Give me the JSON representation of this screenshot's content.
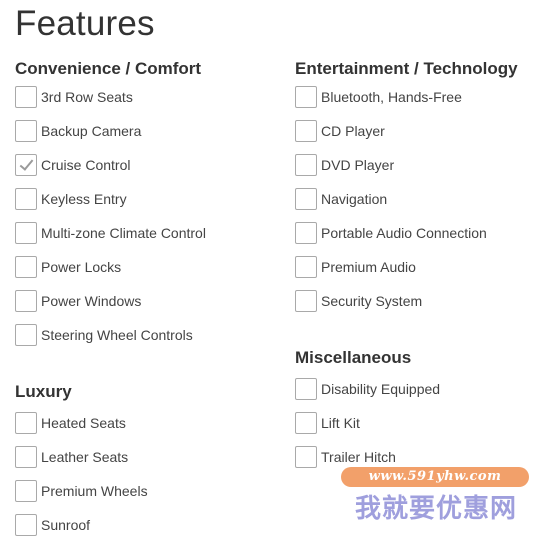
{
  "page": {
    "title": "Features"
  },
  "groups": {
    "convenience": {
      "heading": "Convenience / Comfort",
      "items": [
        {
          "label": "3rd Row Seats",
          "checked": false
        },
        {
          "label": "Backup Camera",
          "checked": false
        },
        {
          "label": "Cruise Control",
          "checked": true
        },
        {
          "label": "Keyless Entry",
          "checked": false
        },
        {
          "label": "Multi-zone Climate Control",
          "checked": false
        },
        {
          "label": "Power Locks",
          "checked": false
        },
        {
          "label": "Power Windows",
          "checked": false
        },
        {
          "label": "Steering Wheel Controls",
          "checked": false
        }
      ]
    },
    "luxury": {
      "heading": "Luxury",
      "items": [
        {
          "label": "Heated Seats",
          "checked": false
        },
        {
          "label": "Leather Seats",
          "checked": false
        },
        {
          "label": "Premium Wheels",
          "checked": false
        },
        {
          "label": "Sunroof",
          "checked": false
        }
      ]
    },
    "entertainment": {
      "heading": "Entertainment / Technology",
      "items": [
        {
          "label": "Bluetooth, Hands-Free",
          "checked": false
        },
        {
          "label": "CD Player",
          "checked": false
        },
        {
          "label": "DVD Player",
          "checked": false
        },
        {
          "label": "Navigation",
          "checked": false
        },
        {
          "label": "Portable Audio Connection",
          "checked": false
        },
        {
          "label": "Premium Audio",
          "checked": false
        },
        {
          "label": "Security System",
          "checked": false
        }
      ]
    },
    "misc": {
      "heading": "Miscellaneous",
      "items": [
        {
          "label": "Disability Equipped",
          "checked": false
        },
        {
          "label": "Lift Kit",
          "checked": false
        },
        {
          "label": "Trailer Hitch",
          "checked": false
        }
      ]
    }
  },
  "watermark": {
    "url": "www.591yhw.com",
    "text": "我就要优惠网"
  },
  "colors": {
    "text": "#333333",
    "checkbox_border": "#a9a9a9",
    "checkmark": "#9a9a9a",
    "watermark_badge": "#f2a06a",
    "watermark_text": "#8f8fd8"
  }
}
